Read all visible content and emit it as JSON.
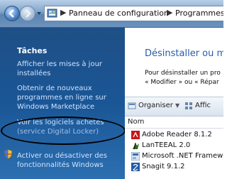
{
  "address": {
    "crumbs": [
      "Panneau de configuration",
      "Programmes et fo"
    ]
  },
  "tasks": {
    "heading": "Tâches",
    "links": [
      {
        "lines": [
          "Afficher les mises à jour",
          "installées"
        ]
      },
      {
        "lines": [
          "Obtenir de nouveaux",
          "programmes en ligne sur",
          "Windows Marketplace"
        ]
      },
      {
        "lines": [
          "Voir les logiciels achetés",
          "(service Digital Locker)"
        ]
      },
      {
        "lines": [
          "Activer ou désactiver des",
          "fonctionnalités Windows"
        ]
      }
    ]
  },
  "main": {
    "title": "Désinstaller ou mo",
    "description": [
      "Pour désinstaller un pro",
      "« Modifier » ou « Répar"
    ]
  },
  "toolbar": {
    "organize_label": "Organiser",
    "view_label": "Affic"
  },
  "list": {
    "column_name": "Nom",
    "programs": [
      {
        "name": "Adobe Reader 8.1.2",
        "icon": "adobe-icon"
      },
      {
        "name": "LanTEEAL 2.0",
        "icon": "app-icon"
      },
      {
        "name": "Microsoft .NET Framewo",
        "icon": "dotnet-icon"
      },
      {
        "name": "Snagit 9.1.2",
        "icon": "snagit-icon"
      }
    ]
  },
  "colors": {
    "left_pane": "#1a5696",
    "link": "#cfe4ff",
    "title_blue": "#2a5aa8"
  }
}
